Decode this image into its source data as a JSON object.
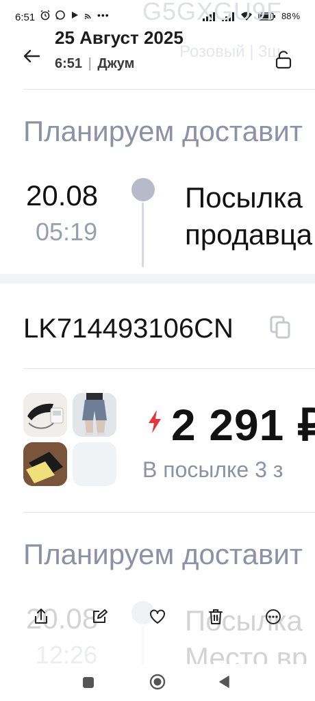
{
  "status_bar": {
    "time": "6:51",
    "battery": "88",
    "icons_left": [
      "alarm-icon",
      "whatsapp-icon",
      "play-icon",
      "cast-icon",
      "more-notifications-icon"
    ],
    "icons_right": [
      "signal-icon",
      "signal-icon",
      "wifi-icon",
      "battery-icon"
    ]
  },
  "background_header": {
    "title": "G5GXGU9F",
    "subtitle": "Розовый | 3ш"
  },
  "photo_header": {
    "date": "25 Август 2025",
    "time": "6:51",
    "source": "Джум"
  },
  "tracking_block_1": {
    "heading": "Планируем доставит",
    "date": "20.08",
    "time": "05:19",
    "line1": "Посылка",
    "line2": "продавца"
  },
  "parcel": {
    "tracking_number": "LK714493106CN",
    "price": "2 291 ₽",
    "items_info": "В посылке 3 з",
    "thumbnails": [
      "tonometer",
      "denim-shorts",
      "insoles",
      "empty"
    ]
  },
  "tracking_block_2": {
    "heading": "Планируем доставит",
    "date": "20.08",
    "time": "12:26",
    "line1": "Посылка",
    "line2": "Место вр"
  },
  "actions": [
    "share-icon",
    "edit-icon",
    "favorite-icon",
    "delete-icon",
    "more-icon"
  ],
  "colors": {
    "muted_text": "#8d90a6",
    "accent_red": "#e5373b",
    "divider": "#e3e5ea",
    "timeline_dot": "#b7bac8"
  }
}
